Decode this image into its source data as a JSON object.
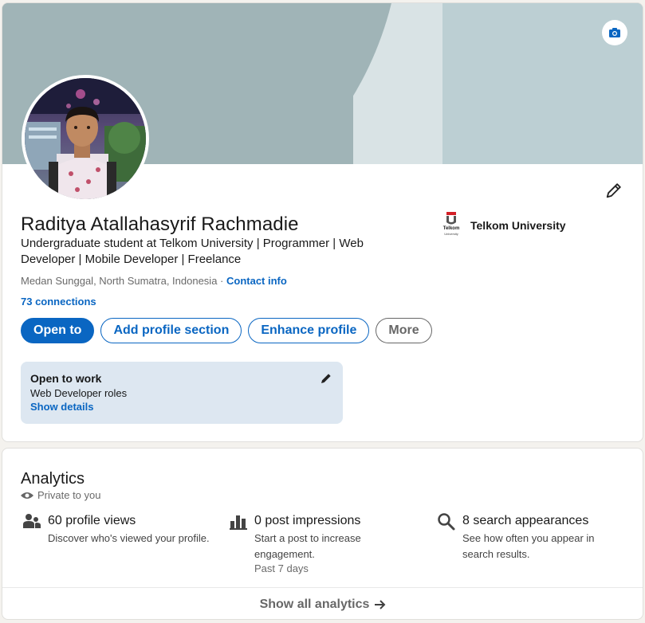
{
  "profile": {
    "name": "Raditya Atallahasyrif Rachmadie",
    "headline": "Undergraduate student at Telkom University | Programmer | Web Developer | Mobile Developer | Freelance",
    "location": "Medan Sunggal, North Sumatra, Indonesia",
    "separator": " · ",
    "contact_info_label": "Contact info",
    "connections_label": "73 connections",
    "education": {
      "name": "Telkom University",
      "logo_text": "Telkom",
      "logo_subtext": "University"
    },
    "actions": {
      "open_to": "Open to",
      "add_section": "Add profile section",
      "enhance": "Enhance profile",
      "more": "More"
    },
    "open_to_work": {
      "title": "Open to work",
      "roles": "Web Developer roles",
      "link": "Show details"
    }
  },
  "analytics": {
    "title": "Analytics",
    "visibility": "Private to you",
    "metrics": [
      {
        "icon": "people-icon",
        "title": "60 profile views",
        "desc": "Discover who's viewed your profile.",
        "sub": ""
      },
      {
        "icon": "bar-chart-icon",
        "title": "0 post impressions",
        "desc": "Start a post to increase engagement.",
        "sub": "Past 7 days"
      },
      {
        "icon": "search-icon",
        "title": "8 search appearances",
        "desc": "See how often you appear in search results.",
        "sub": ""
      }
    ],
    "show_all": "Show all analytics"
  },
  "colors": {
    "accent": "#0a66c2",
    "banner": "#a0b4b7",
    "open_to_work_bg": "#dde7f1"
  }
}
